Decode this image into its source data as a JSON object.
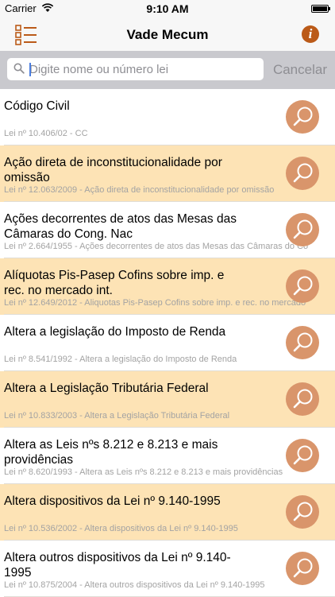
{
  "status_bar": {
    "carrier": "Carrier",
    "time": "9:10 AM"
  },
  "nav": {
    "title": "Vade Mecum",
    "menu_icon": "list-menu-icon",
    "info_icon": "info-icon",
    "info_glyph": "i"
  },
  "search": {
    "placeholder": "Digite nome ou número lei",
    "value": "",
    "cancel_label": "Cancelar"
  },
  "colors": {
    "accent": "#bb5a18",
    "row_highlight": "#fde3b5",
    "search_button": "#d9956b"
  },
  "laws": [
    {
      "title": "Código Civil",
      "subtitle": "Lei nº 10.406/02 - CC"
    },
    {
      "title": "Ação direta de inconstitucionalidade por omissão",
      "subtitle": "Lei nº 12.063/2009 - Ação direta de inconstitucionalidade por omissão"
    },
    {
      "title": "Ações decorrentes de atos das Mesas das Câmaras do Cong. Nac",
      "subtitle": "Lei nº 2.664/1955 - Ações decorrentes de atos das Mesas das Câmaras do Co"
    },
    {
      "title": "Alíquotas Pis-Pasep Cofins sobre imp. e rec. no mercado int.",
      "subtitle": "Lei nº 12.649/2012 - Aliquotas Pis-Pasep Cofins sobre imp. e rec. no mercado"
    },
    {
      "title": "Altera a legislação do Imposto de Renda",
      "subtitle": "Lei nº 8.541/1992 - Altera a legislação do Imposto de Renda"
    },
    {
      "title": "Altera a Legislação Tributária Federal",
      "subtitle": "Lei nº 10.833/2003 - Altera a Legislação Tributária Federal"
    },
    {
      "title": "Altera as Leis nºs 8.212 e 8.213 e mais providências",
      "subtitle": "Lei nº 8.620/1993 - Altera as Leis nºs 8.212 e 8.213 e mais providências"
    },
    {
      "title": "Altera dispositivos da Lei nº 9.140-1995",
      "subtitle": "Lei nº 10.536/2002 - Altera dispositivos da Lei nº 9.140-1995"
    },
    {
      "title": "Altera outros dispositivos da Lei nº 9.140-1995",
      "subtitle": "Lei nº 10.875/2004 - Altera outros dispositivos da Lei nº 9.140-1995"
    }
  ]
}
